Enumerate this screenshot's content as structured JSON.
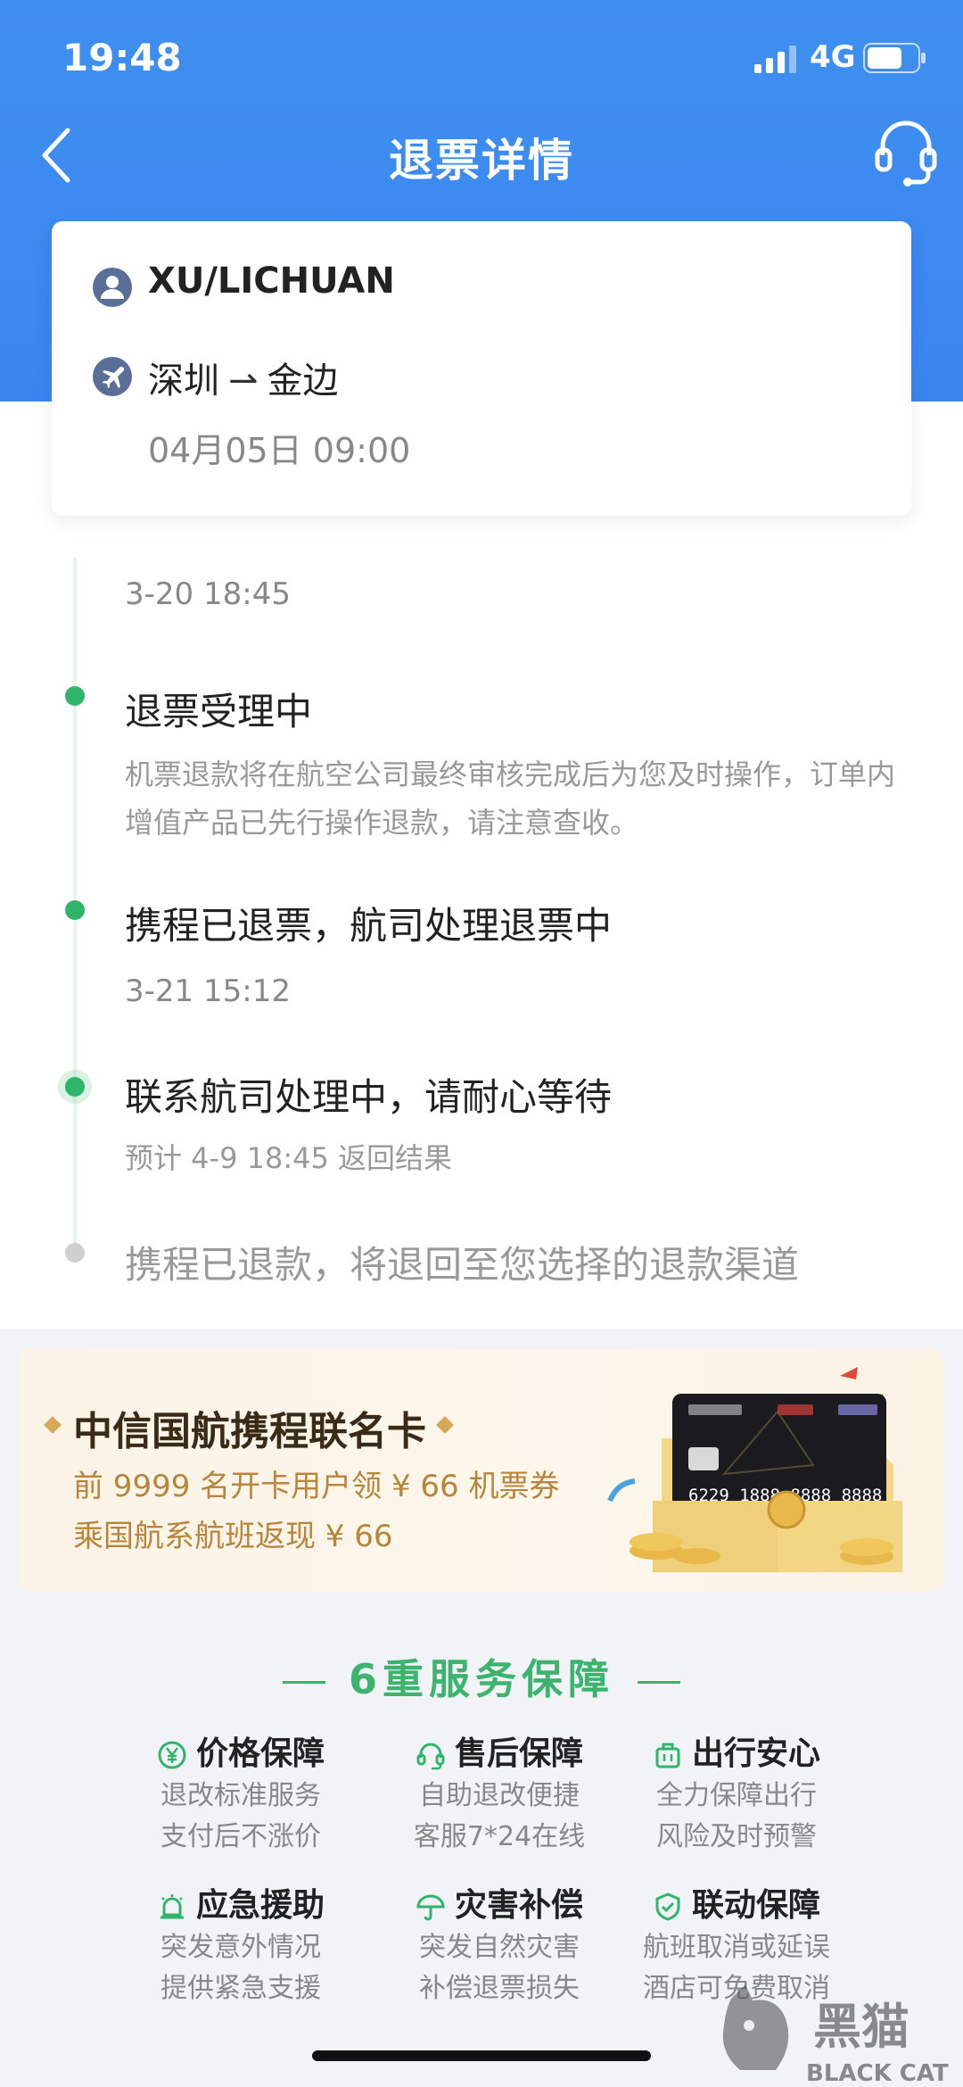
{
  "status_bar": {
    "time": "19:48",
    "network": "4G"
  },
  "nav": {
    "title": "退票详情"
  },
  "passenger": {
    "name": "XU/LICHUAN",
    "route_from": "深圳",
    "route_arrow": "⇀",
    "route_to": "金边",
    "flight_time": "04月05日 09:00"
  },
  "timeline": [
    {
      "timestamp": "3-20 18:45"
    },
    {
      "title": "退票受理中",
      "desc": "机票退款将在航空公司最终审核完成后为您及时操作，订单内增值产品已先行操作退款，请注意查收。"
    },
    {
      "title": "携程已退票，航司处理退票中",
      "timestamp": "3-21 15:12"
    },
    {
      "title": "联系航司处理中，请耐心等待",
      "desc": "预计 4-9 18:45 返回结果"
    },
    {
      "title": "携程已退款，将退回至您选择的退款渠道"
    }
  ],
  "promo": {
    "title": "中信国航携程联名卡",
    "line1": "前 9999 名开卡用户领 ¥ 66 机票券",
    "line2": "乘国航系航班返现 ¥ 66",
    "card_number": "6229 1888 8888 8888"
  },
  "services": {
    "title": "6重服务保障",
    "items": [
      {
        "name": "价格保障",
        "icon": "yen-circle-icon",
        "line1": "退改标准服务",
        "line2": "支付后不涨价"
      },
      {
        "name": "售后保障",
        "icon": "headset-icon",
        "line1": "自助退改便捷",
        "line2": "客服7*24在线"
      },
      {
        "name": "出行安心",
        "icon": "luggage-icon",
        "line1": "全力保障出行",
        "line2": "风险及时预警"
      },
      {
        "name": "应急援助",
        "icon": "alarm-bell-icon",
        "line1": "突发意外情况",
        "line2": "提供紧急支援"
      },
      {
        "name": "灾害补偿",
        "icon": "umbrella-icon",
        "line1": "突发自然灾害",
        "line2": "补偿退票损失"
      },
      {
        "name": "联动保障",
        "icon": "shield-check-icon",
        "line1": "航班取消或延误",
        "line2": "酒店可免费取消"
      }
    ]
  },
  "watermark": {
    "text_cn": "黑猫",
    "text_en": "BLACK CAT"
  },
  "colors": {
    "primary_blue": "#3f8ff0",
    "success_green": "#2fb56a",
    "promo_gold": "#b8853a"
  }
}
